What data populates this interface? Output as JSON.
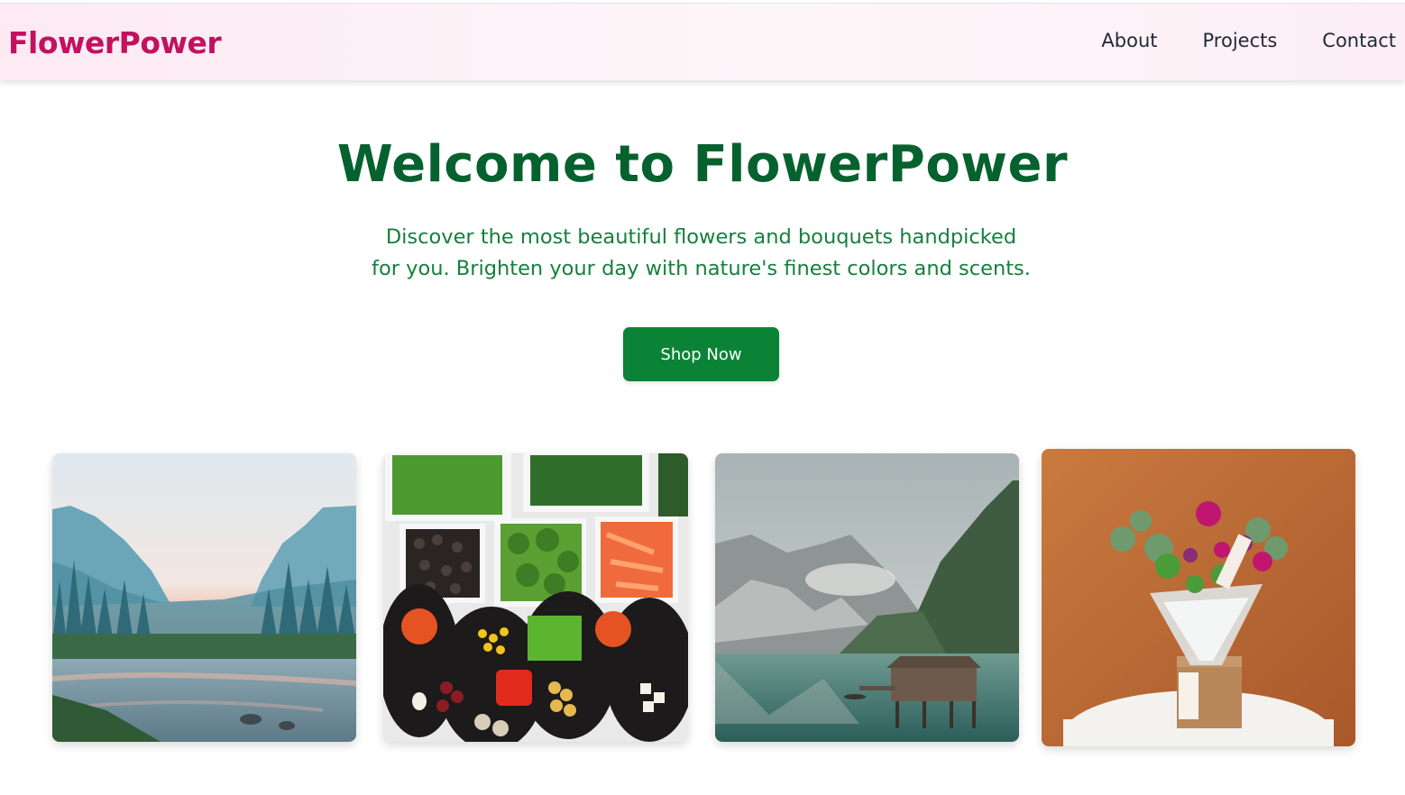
{
  "nav": {
    "brand": "FlowerPower",
    "links": [
      "About",
      "Projects",
      "Contact"
    ]
  },
  "hero": {
    "title": "Welcome to FlowerPower",
    "subtitle_line1": "Discover the most beautiful flowers and bouquets handpicked",
    "subtitle_line2": "for you. Brighten your day with nature's finest colors and scents.",
    "cta_label": "Shop Now"
  },
  "gallery": [
    {
      "subject": "misty valley river landscape"
    },
    {
      "subject": "bowls of fresh vegetables"
    },
    {
      "subject": "mountain lake with boathouse"
    },
    {
      "subject": "flower bouquet in wrapping"
    }
  ],
  "colors": {
    "brand": "#c2125f",
    "title": "#05612e",
    "subtitle": "#15803d",
    "button": "#0a8336",
    "nav_text": "#1f2a37"
  }
}
